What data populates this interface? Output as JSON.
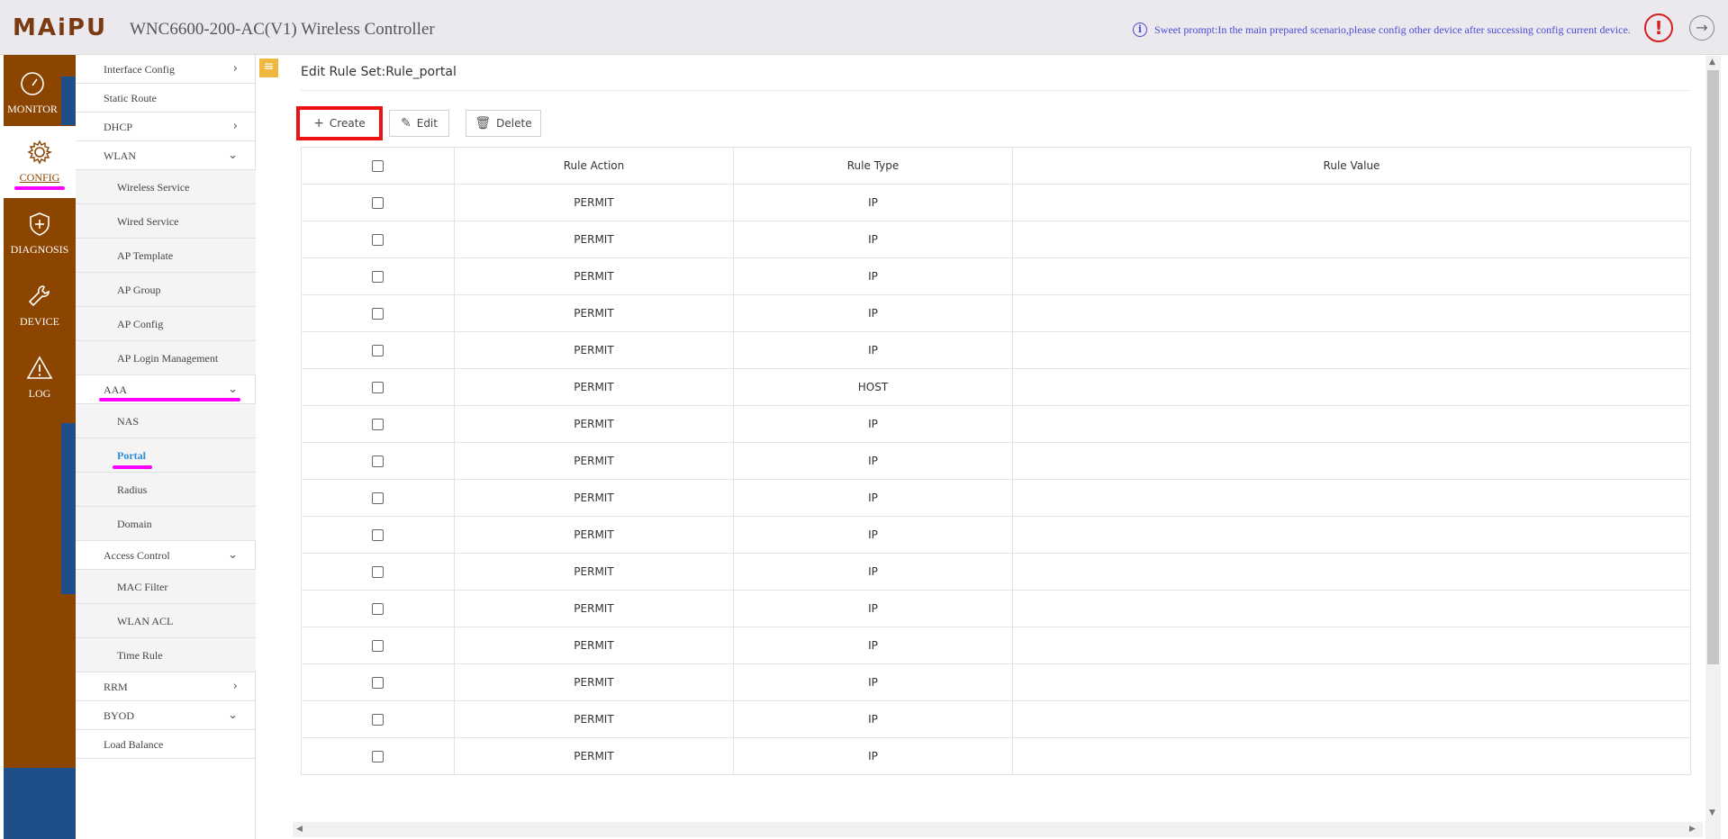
{
  "header": {
    "logo": "MAiPU",
    "title": "WNC6600-200-AC(V1) Wireless Controller",
    "prompt": "Sweet prompt:In the main prepared scenario,please config other device after successing config current device."
  },
  "rail": {
    "items": [
      {
        "label": "MONITOR",
        "icon": "gauge-icon"
      },
      {
        "label": "CONFIG",
        "icon": "gear-icon"
      },
      {
        "label": "DIAGNOSIS",
        "icon": "shield-plus-icon"
      },
      {
        "label": "DEVICE",
        "icon": "wrench-icon"
      },
      {
        "label": "LOG",
        "icon": "warning-triangle-icon"
      }
    ]
  },
  "submenu": {
    "items": [
      {
        "label": "Interface Config",
        "chevron": ">"
      },
      {
        "label": "Static Route",
        "chevron": ""
      },
      {
        "label": "DHCP",
        "chevron": ">"
      },
      {
        "label": "WLAN",
        "chevron": "v"
      },
      {
        "label": "Wireless Service",
        "chevron": ""
      },
      {
        "label": "Wired Service",
        "chevron": ""
      },
      {
        "label": "AP Template",
        "chevron": ""
      },
      {
        "label": "AP Group",
        "chevron": ""
      },
      {
        "label": "AP Config",
        "chevron": ""
      },
      {
        "label": "AP Login Management",
        "chevron": ""
      },
      {
        "label": "AAA",
        "chevron": "v"
      },
      {
        "label": "NAS",
        "chevron": ""
      },
      {
        "label": "Portal",
        "chevron": ""
      },
      {
        "label": "Radius",
        "chevron": ""
      },
      {
        "label": "Domain",
        "chevron": ""
      },
      {
        "label": "Access Control",
        "chevron": "v"
      },
      {
        "label": "MAC Filter",
        "chevron": ""
      },
      {
        "label": "WLAN ACL",
        "chevron": ""
      },
      {
        "label": "Time Rule",
        "chevron": ""
      },
      {
        "label": "RRM",
        "chevron": ">"
      },
      {
        "label": "BYOD",
        "chevron": "v"
      },
      {
        "label": "Load Balance",
        "chevron": ""
      }
    ]
  },
  "main": {
    "title": "Edit Rule Set:Rule_portal",
    "buttons": {
      "create": "Create",
      "edit": "Edit",
      "delete": "Delete"
    },
    "table": {
      "headers": [
        "",
        "Rule Action",
        "Rule Type",
        "Rule Value"
      ],
      "rows": [
        {
          "action": "PERMIT",
          "type": "IP",
          "value": ""
        },
        {
          "action": "PERMIT",
          "type": "IP",
          "value": ""
        },
        {
          "action": "PERMIT",
          "type": "IP",
          "value": ""
        },
        {
          "action": "PERMIT",
          "type": "IP",
          "value": ""
        },
        {
          "action": "PERMIT",
          "type": "IP",
          "value": ""
        },
        {
          "action": "PERMIT",
          "type": "HOST",
          "value": ""
        },
        {
          "action": "PERMIT",
          "type": "IP",
          "value": ""
        },
        {
          "action": "PERMIT",
          "type": "IP",
          "value": ""
        },
        {
          "action": "PERMIT",
          "type": "IP",
          "value": ""
        },
        {
          "action": "PERMIT",
          "type": "IP",
          "value": ""
        },
        {
          "action": "PERMIT",
          "type": "IP",
          "value": ""
        },
        {
          "action": "PERMIT",
          "type": "IP",
          "value": ""
        },
        {
          "action": "PERMIT",
          "type": "IP",
          "value": ""
        },
        {
          "action": "PERMIT",
          "type": "IP",
          "value": ""
        },
        {
          "action": "PERMIT",
          "type": "IP",
          "value": ""
        },
        {
          "action": "PERMIT",
          "type": "IP",
          "value": ""
        }
      ]
    }
  },
  "colors": {
    "brand_brown": "#8b4500",
    "brand_blue": "#1e4f8a",
    "highlight_red": "#ee1111",
    "annotation_pink": "#ff00ff",
    "selected_blue": "#2e8fd6"
  }
}
